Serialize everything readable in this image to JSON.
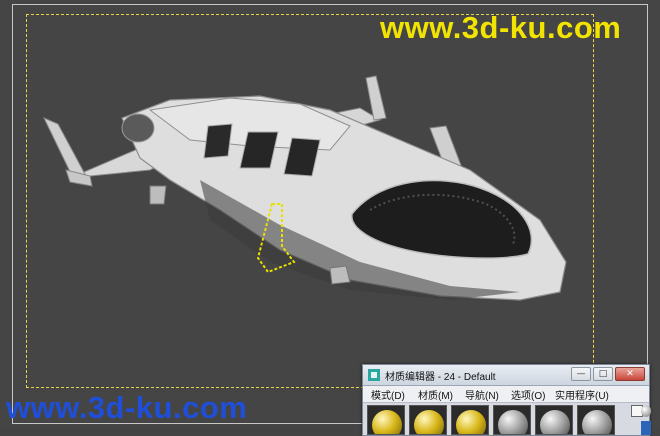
{
  "watermarks": {
    "top": "www.3d-ku.com",
    "bottom": "www.3d-ku.com"
  },
  "material_editor": {
    "title": "材质编辑器 - 24 - Default",
    "window_buttons": {
      "minimize": "—",
      "maximize": "□",
      "close": "✕"
    },
    "menu": [
      "模式(D)",
      "材质(M)",
      "导航(N)",
      "选项(O)",
      "实用程序(U)"
    ],
    "slots": [
      {
        "name": "yellow-material-slot",
        "color": "#d9b81a"
      },
      {
        "name": "yellow-material-slot",
        "color": "#d9b81a"
      },
      {
        "name": "yellow-material-slot",
        "color": "#d9b81a"
      },
      {
        "name": "grey-material-slot",
        "color": "#9a9a9a"
      },
      {
        "name": "grey-material-slot",
        "color": "#9a9a9a"
      },
      {
        "name": "grey-material-slot",
        "color": "#9a9a9a"
      }
    ]
  },
  "colors": {
    "viewport_bg": "#454545",
    "safe_frame": "#e6d44a",
    "watermark_top": "#f2e400",
    "watermark_bottom": "#1f4fd8",
    "selection": "#e8e000"
  }
}
